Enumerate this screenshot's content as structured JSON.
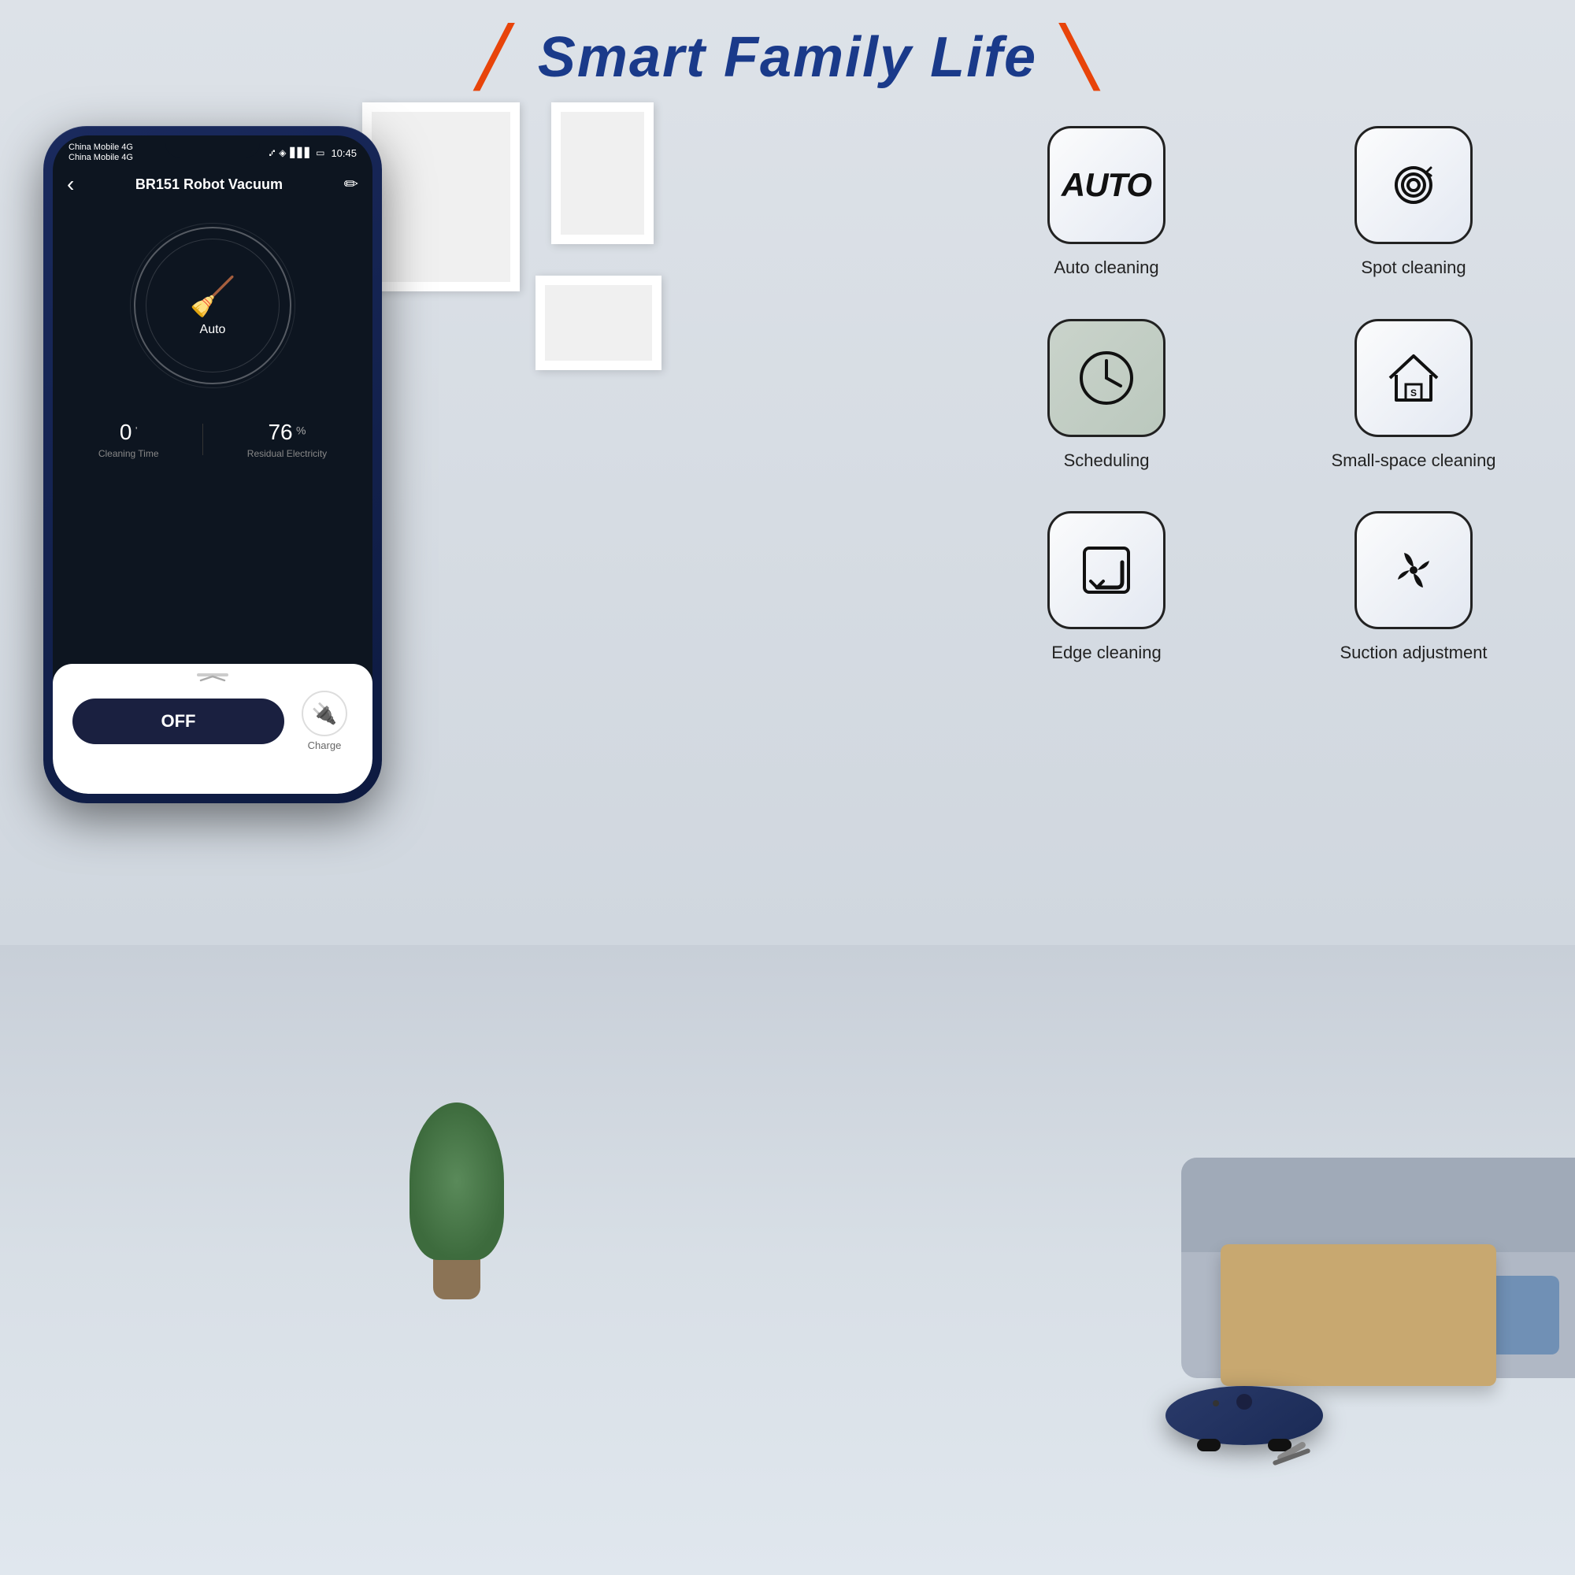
{
  "page": {
    "title": "Smart Family Life",
    "title_slash": "✓",
    "background_color": "#d8dde3"
  },
  "phone": {
    "status_bar": {
      "carrier1": "China Mobile 4G",
      "carrier2": "China Mobile 4G",
      "time": "10:45",
      "signal_icon": "📶",
      "battery_icon": "🔋",
      "bluetooth_icon": "🔵"
    },
    "app_header": {
      "title": "BR151 Robot Vacuum",
      "back_icon": "‹",
      "edit_icon": "✏"
    },
    "vacuum": {
      "mode": "Auto",
      "mode_icon": "🧹"
    },
    "stats": {
      "cleaning_time_value": "0",
      "cleaning_time_unit": "'",
      "cleaning_time_label": "Cleaning Time",
      "electricity_value": "76",
      "electricity_unit": "%",
      "electricity_label": "Residual Electricity"
    },
    "controls": {
      "off_button_label": "OFF",
      "charge_icon": "⚡",
      "charge_label": "Charge"
    }
  },
  "features": [
    {
      "id": "auto-cleaning",
      "icon_type": "auto",
      "icon_text": "AUTO",
      "label": "Auto cleaning"
    },
    {
      "id": "spot-cleaning",
      "icon_type": "spiral",
      "label": "Spot cleaning"
    },
    {
      "id": "scheduling",
      "icon_type": "clock",
      "label": "Scheduling"
    },
    {
      "id": "small-space",
      "icon_type": "house",
      "label": "Small-space cleaning"
    },
    {
      "id": "edge-cleaning",
      "icon_type": "edge",
      "label": "Edge cleaning"
    },
    {
      "id": "suction-adjustment",
      "icon_type": "fan",
      "label": "Suction adjustment"
    }
  ]
}
